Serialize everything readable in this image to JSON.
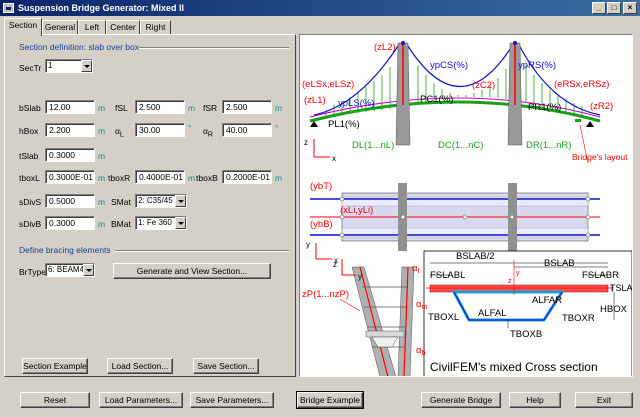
{
  "window": {
    "title": "Suspension Bridge Generator: Mixed II"
  },
  "tabs": [
    "Section",
    "General",
    "Left",
    "Center",
    "Right"
  ],
  "section": {
    "group_label": "Section definition: slab over box",
    "sectr_label": "SecTr",
    "sectr_value": "1",
    "bslab_label": "bSlab",
    "bslab_value": "12.00",
    "bslab_unit": "m",
    "fsl_label": "fSL",
    "fsl_value": "2.500",
    "fsl_unit": "m",
    "fsr_label": "fSR",
    "fsr_value": "2.500",
    "fsr_unit": "m",
    "hbox_label": "hBox",
    "hbox_value": "2.200",
    "hbox_unit": "m",
    "alphal_label": "α",
    "alphal_sub": "L",
    "alphal_value": "30.00",
    "alphal_unit": "°",
    "alphar_label": "α",
    "alphar_sub": "R",
    "alphar_value": "40.00",
    "alphar_unit": "°",
    "tslab_label": "tSlab",
    "tslab_value": "0.3000",
    "tslab_unit": "m",
    "tboxl_label": "tboxL",
    "tboxl_value": "0.3000E-01",
    "tboxl_unit": "m",
    "tboxr_label": "tboxR",
    "tboxr_value": "0.4000E-01",
    "tboxr_unit": "m",
    "tboxb_label": "tboxB",
    "tboxb_value": "0.2000E-01",
    "tboxb_unit": "m",
    "sdivs_label": "sDivS",
    "sdivs_value": "0.5000",
    "sdivs_unit": "m",
    "smat_label": "SMat",
    "smat_value": "2: C35/45",
    "sdivb_label": "sDivB",
    "sdivb_value": "0.3000",
    "sdivb_unit": "m",
    "bmat_label": "BMat",
    "bmat_value": "1: Fe 360",
    "bracing_label": "Define bracing elements",
    "brtype_label": "BrType",
    "brtype_value": "6: BEAM4",
    "generate_view_label": "Generate and View Section...",
    "section_example_label": "Section Example",
    "load_section_label": "Load Section...",
    "save_section_label": "Save Section..."
  },
  "footer": {
    "reset": "Reset",
    "load_params": "Load Parameters...",
    "save_params": "Save Parameters...",
    "bridge_example": "Bridge Example",
    "generate_bridge": "Generate Bridge",
    "help": "Help",
    "exit": "Exit"
  },
  "figure": {
    "zl2": "(zL2)",
    "ypcs": "ypCS(%)",
    "yprs": "ypRS(%)",
    "elsx": "(eLSx,eLSz)",
    "ersx": "(eRSx,eRSz)",
    "zl1": "(zL1)",
    "ypls": "ypLS(%)",
    "pc1": "PC1(%)",
    "zc2": "(zC2)",
    "pr1": "PR1(%)",
    "zr2": "(zR2)",
    "pl1": "PL1(%)",
    "dl": "DL(1...nL)",
    "dc": "DC(1...nC)",
    "dr": "DR(1...nR)",
    "layout": "Bridge's layout",
    "ybt": "(ybT)",
    "xli": "(xLi,yLi)",
    "ybb": "(ybB)",
    "z": "z",
    "x": "x",
    "y": "y",
    "alpha_t": "α",
    "alpha_t_sub": "t",
    "alpha_m": "α",
    "alpha_m_sub": "m",
    "alpha_b": "α",
    "alpha_b_sub": "b",
    "zp": "zP(1...nzP)",
    "bslab2": "BSLAB/2",
    "bslab": "BSLAB",
    "fslabl": "FSLABL",
    "fslabr": "FSLABR",
    "tslab": "TSLAB",
    "alfar": "ALFAR",
    "alfal": "ALFAL",
    "tboxl": "TBOXL",
    "tboxr": "TBOXR",
    "hbox": "HBOX",
    "tboxb": "TBOXB",
    "caption": "CivilFEM's mixed Cross section",
    "colors": {
      "red": "#ff0000",
      "blue": "#1010d0",
      "green": "#18a018",
      "magenta": "#cc00cc"
    }
  }
}
